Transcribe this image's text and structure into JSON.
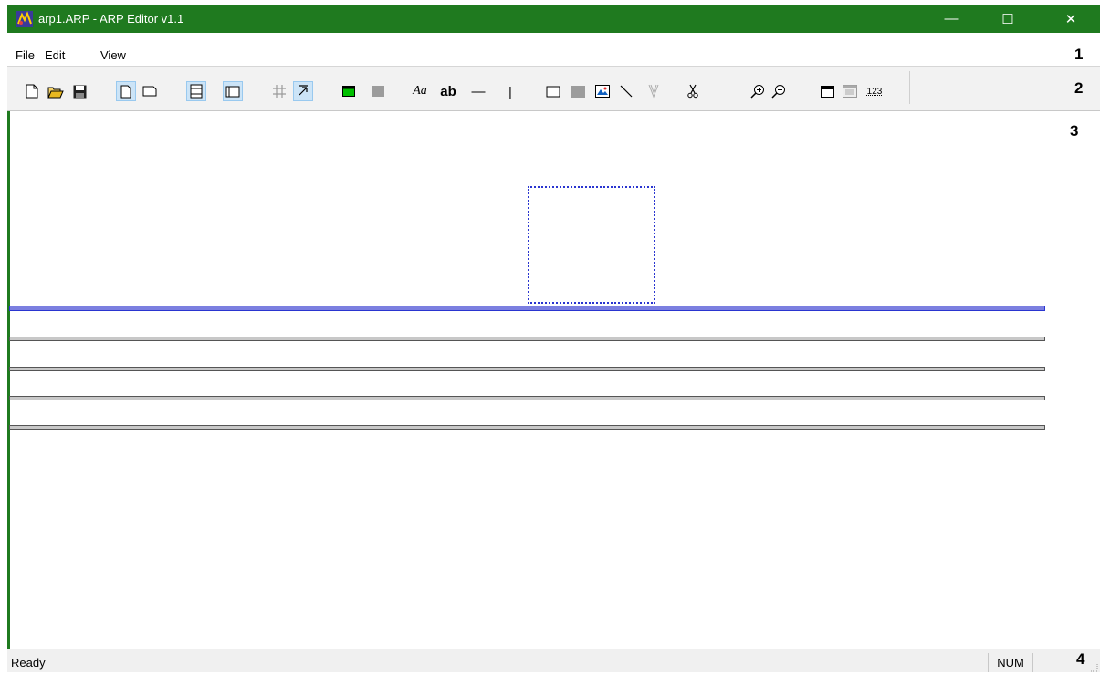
{
  "window": {
    "title": "arp1.ARP - ARP Editor v1.1",
    "colors": {
      "titlebar": "#1f7a1f",
      "selection": "#2a35d0",
      "band_selected": "#7b7fe0",
      "band": "#c8c8c8"
    },
    "controls": {
      "minimize": "—",
      "maximize": "☐",
      "close": "✕"
    }
  },
  "menu": {
    "items": [
      "File",
      "Edit",
      "View"
    ]
  },
  "markers": {
    "menu": "1",
    "toolbar": "2",
    "canvas": "3",
    "status": "4"
  },
  "toolbar": {
    "text_tool": "Aa",
    "text_bold_tool": "ab",
    "hline_tool": "—",
    "vline_tool": "|",
    "number_tool": "123"
  },
  "statusbar": {
    "status": "Ready",
    "num": "NUM"
  }
}
